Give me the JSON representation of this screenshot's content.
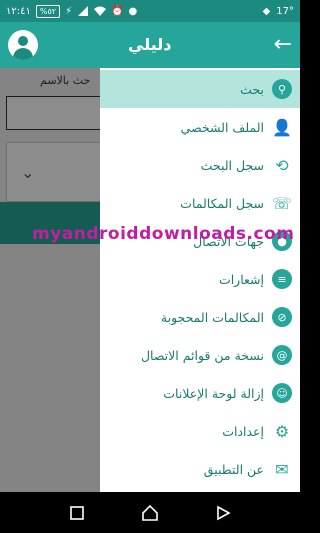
{
  "status_bar": {
    "time": "١٢:٤١",
    "battery": "%٥٢",
    "temperature": "17°"
  },
  "app_bar": {
    "title": "دليلي"
  },
  "background": {
    "search_label": "حث بالاسم"
  },
  "drawer": {
    "items": [
      {
        "label": "بحث",
        "icon": "search-icon",
        "active": true
      },
      {
        "label": "الملف الشخصي",
        "icon": "profile-icon",
        "active": false
      },
      {
        "label": "سجل البحث",
        "icon": "history-icon",
        "active": false
      },
      {
        "label": "سجل المكالمات",
        "icon": "call-log-icon",
        "active": false
      },
      {
        "label": "جهات الاتصال",
        "icon": "contacts-icon",
        "active": false
      },
      {
        "label": "إشعارات",
        "icon": "notifications-icon",
        "active": false
      },
      {
        "label": "المكالمات المحجوبة",
        "icon": "blocked-calls-icon",
        "active": false
      },
      {
        "label": "نسخة من قوائم الاتصال",
        "icon": "backup-contacts-icon",
        "active": false
      },
      {
        "label": "إزالة لوحة الإعلانات",
        "icon": "remove-ads-icon",
        "active": false
      },
      {
        "label": "إعدادات",
        "icon": "settings-icon",
        "active": false
      },
      {
        "label": "عن التطبيق",
        "icon": "about-icon",
        "active": false
      }
    ]
  },
  "watermark": "myandroiddownloads.com",
  "colors": {
    "primary": "#26a69a",
    "primary_dark": "#1c8a80",
    "active_item": "#b3e5dd",
    "watermark": "#c21ea0"
  }
}
